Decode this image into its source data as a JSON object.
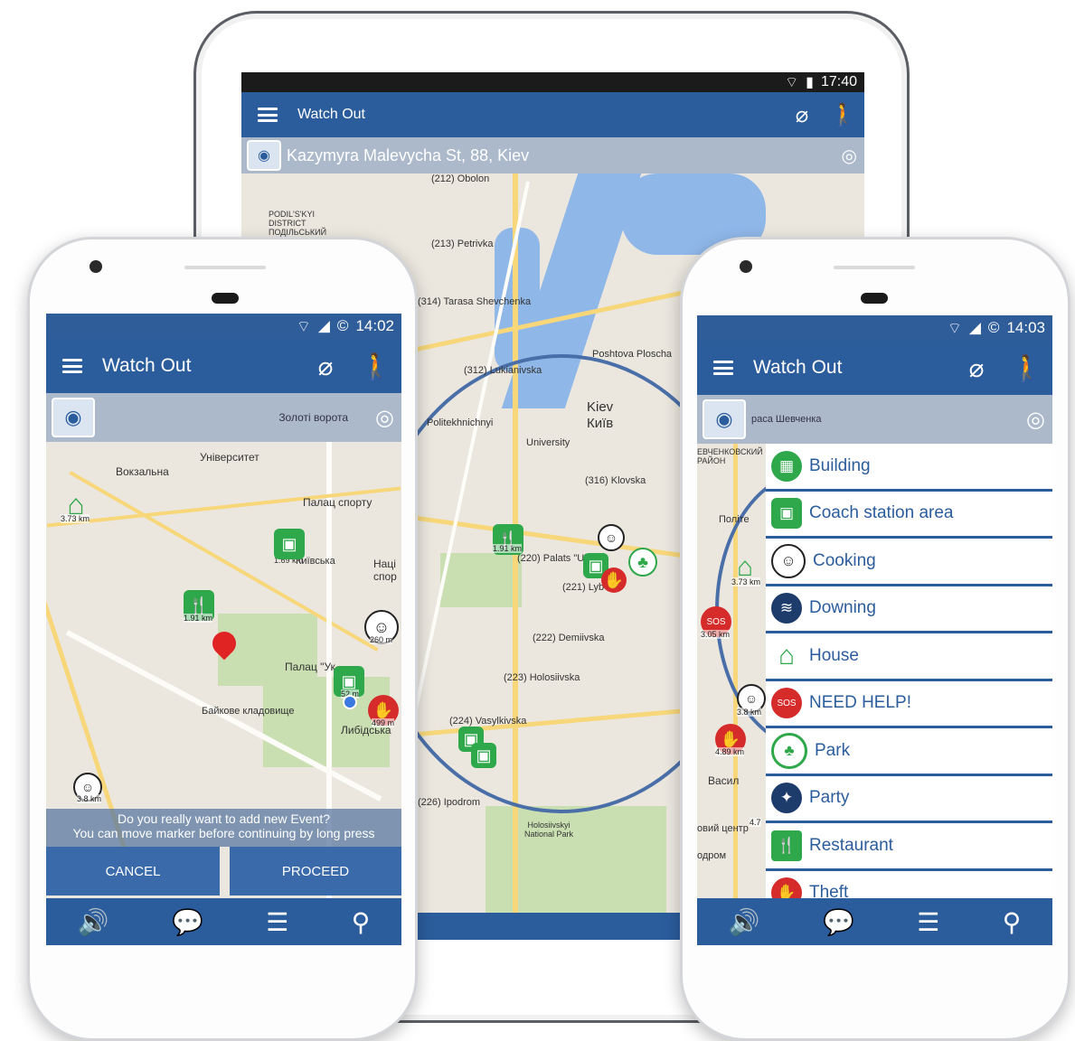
{
  "tablet": {
    "status": {
      "time": "17:40",
      "signal": "▲▲▐"
    },
    "app_title": "Watch Out",
    "address": "Kazymyra Malevycha St, 88, Kiev",
    "map_labels": [
      "(212) Obolon",
      "PODIL'S'KYI DISTRICT ПОДІЛЬСЬКИЙ",
      "(213) Petrivka",
      "(314) Tarasa Shevchenka",
      "Poshtova Ploscha",
      "(312) Lukianivska",
      "Kiev",
      "Київ",
      "Politekhnichnyi",
      "University",
      "(316) Klovska",
      "(220) Palats \"Ukr",
      "(221) Lyb",
      "(222) Demiivska",
      "(223) Holosiivska",
      "(224) Vasylkivska",
      "(226) Ipodrom",
      "Holosiivskyi National Park"
    ],
    "distances": [
      "1.91 km"
    ]
  },
  "phone_left": {
    "status": {
      "time": "14:02"
    },
    "app_title": "Watch Out",
    "address": "Золоті ворота",
    "map_labels": [
      "Університет",
      "Вокзальна",
      "Палац спорту",
      "Наці спор",
      "1.69 km",
      "Київська",
      "Палац \"Ук",
      "Байкове кладовище",
      "Либідська"
    ],
    "distances": [
      "3.73 km",
      "1.91 km",
      "260 m",
      "52 m",
      "499 m",
      "3.8 km"
    ],
    "dialog": {
      "line1": "Do you really want to add new Event?",
      "line2": "You can move marker before continuing by long press"
    },
    "buttons": {
      "cancel": "CANCEL",
      "proceed": "PROCEED"
    }
  },
  "phone_right": {
    "status": {
      "time": "14:03"
    },
    "app_title": "Watch Out",
    "address": "раса Шевченка",
    "map_labels": [
      "ЕВЧЕНКОВСКИЙ РАЙОН",
      "Політе",
      "Васил",
      "овий центр",
      "одром"
    ],
    "distances": [
      "3.73 km",
      "3.05 km",
      "3.8 km",
      "4.89 km",
      "4.7"
    ],
    "categories": [
      {
        "label": "Building",
        "icon": "building-icon",
        "color": "#2ea84a"
      },
      {
        "label": "Coach station area",
        "icon": "bus-icon",
        "color": "#2ea84a"
      },
      {
        "label": "Cooking",
        "icon": "chef-icon",
        "color": "#222222"
      },
      {
        "label": "Downing",
        "icon": "drowning-icon",
        "color": "#1d3b6b"
      },
      {
        "label": "House",
        "icon": "house-icon",
        "color": "#2ea84a"
      },
      {
        "label": "NEED HELP!",
        "icon": "sos-icon",
        "color": "#d62b2b"
      },
      {
        "label": "Park",
        "icon": "tree-icon",
        "color": "#2ea84a"
      },
      {
        "label": "Party",
        "icon": "party-icon",
        "color": "#1d3b6b"
      },
      {
        "label": "Restaurant",
        "icon": "restaurant-icon",
        "color": "#2ea84a"
      },
      {
        "label": "Theft",
        "icon": "theft-icon",
        "color": "#d62b2b"
      }
    ]
  },
  "colors": {
    "primary": "#2b5c9c",
    "green": "#2ea84a",
    "red": "#d62b2b"
  }
}
